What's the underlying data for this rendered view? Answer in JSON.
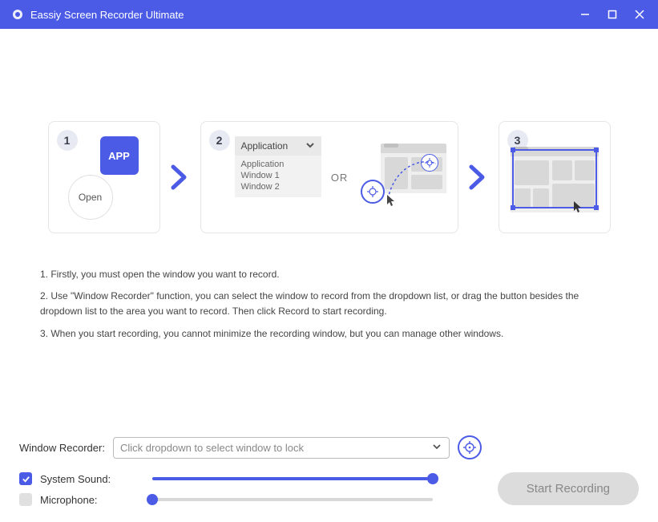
{
  "title": "Eassiy Screen Recorder Ultimate",
  "steps": {
    "s1": {
      "num": "1",
      "app_label": "APP",
      "open_label": "Open"
    },
    "s2": {
      "num": "2",
      "dd_title": "Application",
      "dd_list_title": "Application",
      "w1": "Window 1",
      "w2": "Window 2",
      "or": "OR"
    },
    "s3": {
      "num": "3"
    }
  },
  "instructions": {
    "i1": "1. Firstly, you must open the window you want to record.",
    "i2": "2. Use \"Window Recorder\" function, you can select the window to record from the dropdown list, or drag the button besides the dropdown list to the area you want to record. Then click Record to start recording.",
    "i3": "3. When you start recording, you cannot minimize the recording window, but you can manage other windows."
  },
  "bottom": {
    "label": "Window Recorder:",
    "dropdown_placeholder": "Click dropdown to select window to lock",
    "system_sound": "System Sound:",
    "microphone": "Microphone:",
    "start": "Start Recording",
    "system_sound_checked": true,
    "microphone_checked": false,
    "system_sound_level": 100,
    "microphone_level": 0
  }
}
